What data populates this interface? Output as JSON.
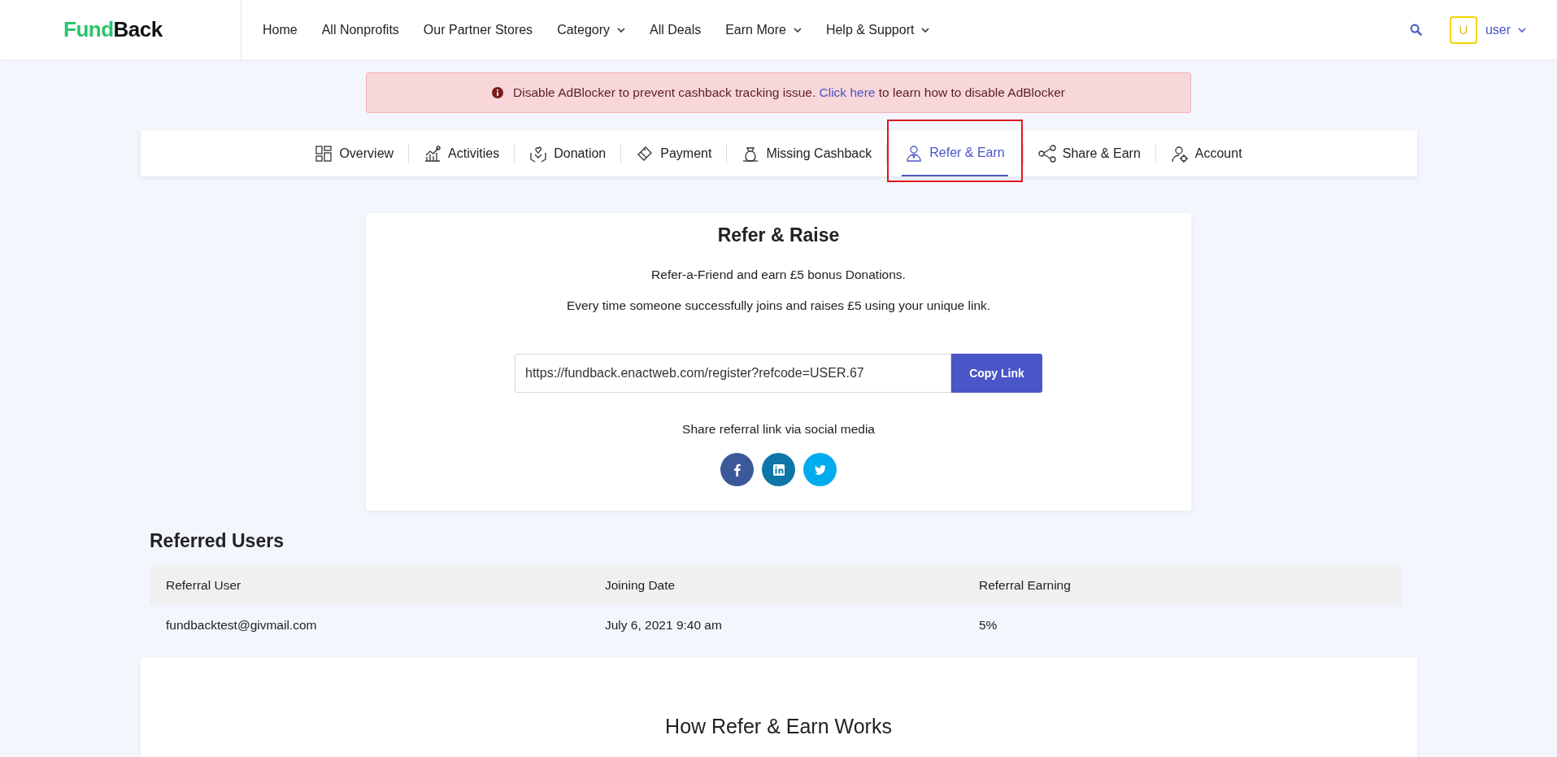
{
  "header": {
    "logo": {
      "part_1": "Fund",
      "part_2": "Back"
    },
    "nav": [
      {
        "label": "Home",
        "dropdown": false
      },
      {
        "label": "All Nonprofits",
        "dropdown": false
      },
      {
        "label": "Our Partner Stores",
        "dropdown": false
      },
      {
        "label": "Category",
        "dropdown": true
      },
      {
        "label": "All Deals",
        "dropdown": false
      },
      {
        "label": "Earn More",
        "dropdown": true
      },
      {
        "label": "Help & Support",
        "dropdown": true
      }
    ],
    "user": {
      "initial": "U",
      "name": "user"
    }
  },
  "alert": {
    "text_before": "Disable AdBlocker to prevent cashback tracking issue.",
    "link": "Click here",
    "text_after": "to learn how to disable AdBlocker"
  },
  "tabs": [
    {
      "label": "Overview",
      "kind": "overview",
      "selected": false,
      "highlighted": false
    },
    {
      "label": "Activities",
      "kind": "activities",
      "selected": false,
      "highlighted": false
    },
    {
      "label": "Donation",
      "kind": "donation",
      "selected": false,
      "highlighted": false
    },
    {
      "label": "Payment",
      "kind": "payment",
      "selected": false,
      "highlighted": false
    },
    {
      "label": "Missing Cashback",
      "kind": "cashback",
      "selected": false,
      "highlighted": false
    },
    {
      "label": "Refer & Earn",
      "kind": "refer",
      "selected": true,
      "highlighted": true
    },
    {
      "label": "Share & Earn",
      "kind": "share",
      "selected": false,
      "highlighted": false
    },
    {
      "label": "Account",
      "kind": "account",
      "selected": false,
      "highlighted": false
    }
  ],
  "refer_card": {
    "title": "Refer & Raise",
    "lines": [
      "Refer-a-Friend and earn £5 bonus Donations.",
      "Every time someone successfully joins and raises £5 using your unique link."
    ],
    "link_value": "https://fundback.enactweb.com/register?refcode=USER.67",
    "copy_button": "Copy Link",
    "share_label": "Share referral link via social media",
    "social": [
      {
        "kind": "facebook",
        "color": "#3b5998"
      },
      {
        "kind": "linkedin",
        "color": "#0e76a8"
      },
      {
        "kind": "twitter",
        "color": "#00aced"
      }
    ]
  },
  "referred_users": {
    "title": "Referred Users",
    "columns": [
      "Referral User",
      "Joining Date",
      "Referral Earning"
    ],
    "rows": [
      [
        "fundbacktest@givmail.com",
        "July 6, 2021 9:40 am",
        "5%"
      ]
    ]
  },
  "how_it_works": {
    "title": "How Refer & Earn Works"
  }
}
